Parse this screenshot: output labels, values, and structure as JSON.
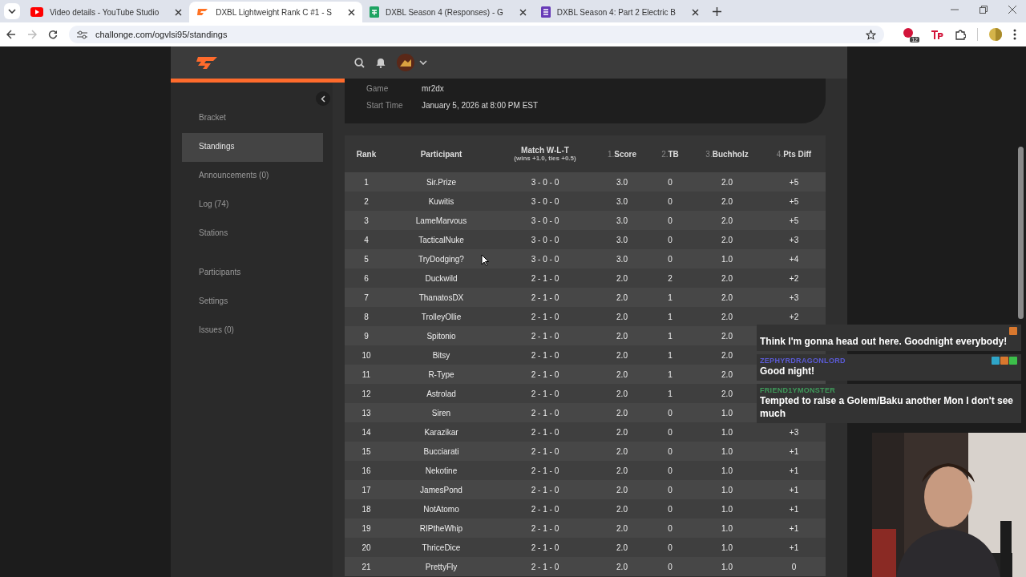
{
  "browser": {
    "tabs": [
      {
        "title": "Video details - YouTube Studio",
        "selected": false
      },
      {
        "title": "DXBL Lightweight Rank C #1 - S",
        "selected": true
      },
      {
        "title": "DXBL Season 4 (Responses) - G",
        "selected": false
      },
      {
        "title": "DXBL Season 4: Part 2 Electric B",
        "selected": false
      }
    ],
    "address": "challonge.com/ogvlsi95/standings",
    "extension_badge": "12"
  },
  "sidebar": {
    "sections": [
      {
        "items": [
          {
            "label": "Bracket",
            "selected": false
          },
          {
            "label": "Standings",
            "selected": true
          },
          {
            "label": "Announcements (0)",
            "selected": false
          },
          {
            "label": "Log (74)",
            "selected": false
          },
          {
            "label": "Stations",
            "selected": false
          }
        ]
      },
      {
        "items": [
          {
            "label": "Participants",
            "selected": false
          },
          {
            "label": "Settings",
            "selected": false
          },
          {
            "label": "Issues (0)",
            "selected": false
          }
        ]
      }
    ]
  },
  "details": [
    {
      "label": "Game",
      "value": "mr2dx"
    },
    {
      "label": "Start Time",
      "value": "January 5, 2026 at 8:00 PM EST"
    }
  ],
  "table": {
    "columns": [
      {
        "label": "Rank"
      },
      {
        "label": "Participant"
      },
      {
        "label": "Match W-L-T",
        "sub": "(wins +1.0, ties +0.5)"
      },
      {
        "prefix": "1.",
        "label": "Score"
      },
      {
        "prefix": "2.",
        "label": "TB"
      },
      {
        "prefix": "3.",
        "label": "Buchholz"
      },
      {
        "prefix": "4.",
        "label": "Pts Diff"
      }
    ],
    "rows": [
      [
        "1",
        "Sir.Prize",
        "3 - 0 - 0",
        "3.0",
        "0",
        "2.0",
        "+5"
      ],
      [
        "2",
        "Kuwitis",
        "3 - 0 - 0",
        "3.0",
        "0",
        "2.0",
        "+5"
      ],
      [
        "3",
        "LameMarvous",
        "3 - 0 - 0",
        "3.0",
        "0",
        "2.0",
        "+5"
      ],
      [
        "4",
        "TacticalNuke",
        "3 - 0 - 0",
        "3.0",
        "0",
        "2.0",
        "+3"
      ],
      [
        "5",
        "TryDodging?",
        "3 - 0 - 0",
        "3.0",
        "0",
        "1.0",
        "+4"
      ],
      [
        "6",
        "Duckwild",
        "2 - 1 - 0",
        "2.0",
        "2",
        "2.0",
        "+2"
      ],
      [
        "7",
        "ThanatosDX",
        "2 - 1 - 0",
        "2.0",
        "1",
        "2.0",
        "+3"
      ],
      [
        "8",
        "TrolleyOllie",
        "2 - 1 - 0",
        "2.0",
        "1",
        "2.0",
        "+2"
      ],
      [
        "9",
        "Spitonio",
        "2 - 1 - 0",
        "2.0",
        "1",
        "2.0"
      ],
      [
        "10",
        "Bitsy",
        "2 - 1 - 0",
        "2.0",
        "1",
        "2.0"
      ],
      [
        "11",
        "R-Type",
        "2 - 1 - 0",
        "2.0",
        "1",
        "2.0"
      ],
      [
        "12",
        "Astrolad",
        "2 - 1 - 0",
        "2.0",
        "1",
        "2.0"
      ],
      [
        "13",
        "Siren",
        "2 - 1 - 0",
        "2.0",
        "0",
        "1.0"
      ],
      [
        "14",
        "Karazikar",
        "2 - 1 - 0",
        "2.0",
        "0",
        "1.0",
        "+3"
      ],
      [
        "15",
        "Bucciarati",
        "2 - 1 - 0",
        "2.0",
        "0",
        "1.0",
        "+1"
      ],
      [
        "16",
        "Nekotine",
        "2 - 1 - 0",
        "2.0",
        "0",
        "1.0",
        "+1"
      ],
      [
        "17",
        "JamesPond",
        "2 - 1 - 0",
        "2.0",
        "0",
        "1.0",
        "+1"
      ],
      [
        "18",
        "NotAtomo",
        "2 - 1 - 0",
        "2.0",
        "0",
        "1.0",
        "+1"
      ],
      [
        "19",
        "RIPtheWhip",
        "2 - 1 - 0",
        "2.0",
        "0",
        "1.0",
        "+1"
      ],
      [
        "20",
        "ThriceDice",
        "2 - 1 - 0",
        "2.0",
        "0",
        "1.0",
        "+1"
      ],
      [
        "21",
        "PrettyFly",
        "2 - 1 - 0",
        "2.0",
        "0",
        "1.0",
        "0"
      ]
    ]
  },
  "chat": [
    {
      "message": "Think I'm gonna head out here. Goodnight everybody!"
    },
    {
      "user": "ZEPHYRDRAGONLORD",
      "color": "#5b5bd6",
      "message": "Good night!"
    },
    {
      "user": "FRIEND1YMONSTER",
      "color": "#3f9a5a",
      "message": "Tempted to raise a Golem/Baku another Mon I don't see much"
    }
  ]
}
